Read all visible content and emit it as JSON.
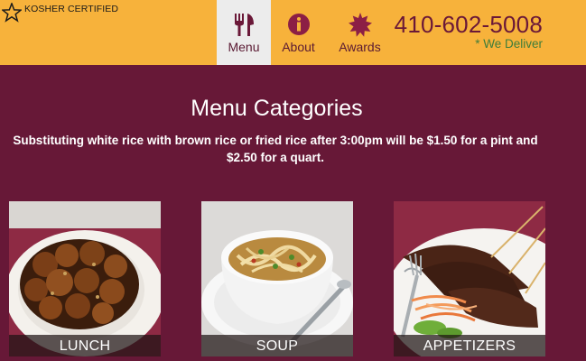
{
  "header": {
    "kosher_label": "KOSHER CERTIFIED",
    "phone": "410-602-5008",
    "delivery": "* We Deliver",
    "nav": [
      {
        "label": "Menu",
        "icon": "fork-knife-icon",
        "active": true
      },
      {
        "label": "About",
        "icon": "info-icon",
        "active": false
      },
      {
        "label": "Awards",
        "icon": "award-star-icon",
        "active": false
      }
    ]
  },
  "main": {
    "title": "Menu Categories",
    "note": "Substituting white rice with brown rice or fried rice after 3:00pm will be $1.50 for a pint and $2.50 for a quart.",
    "categories": [
      {
        "label": "LUNCH"
      },
      {
        "label": "SOUP"
      },
      {
        "label": "APPETIZERS"
      }
    ]
  },
  "colors": {
    "header_bg": "#f7b23b",
    "page_bg": "#671837",
    "accent": "#6a1838",
    "delivery_green": "#3f7d3a"
  }
}
